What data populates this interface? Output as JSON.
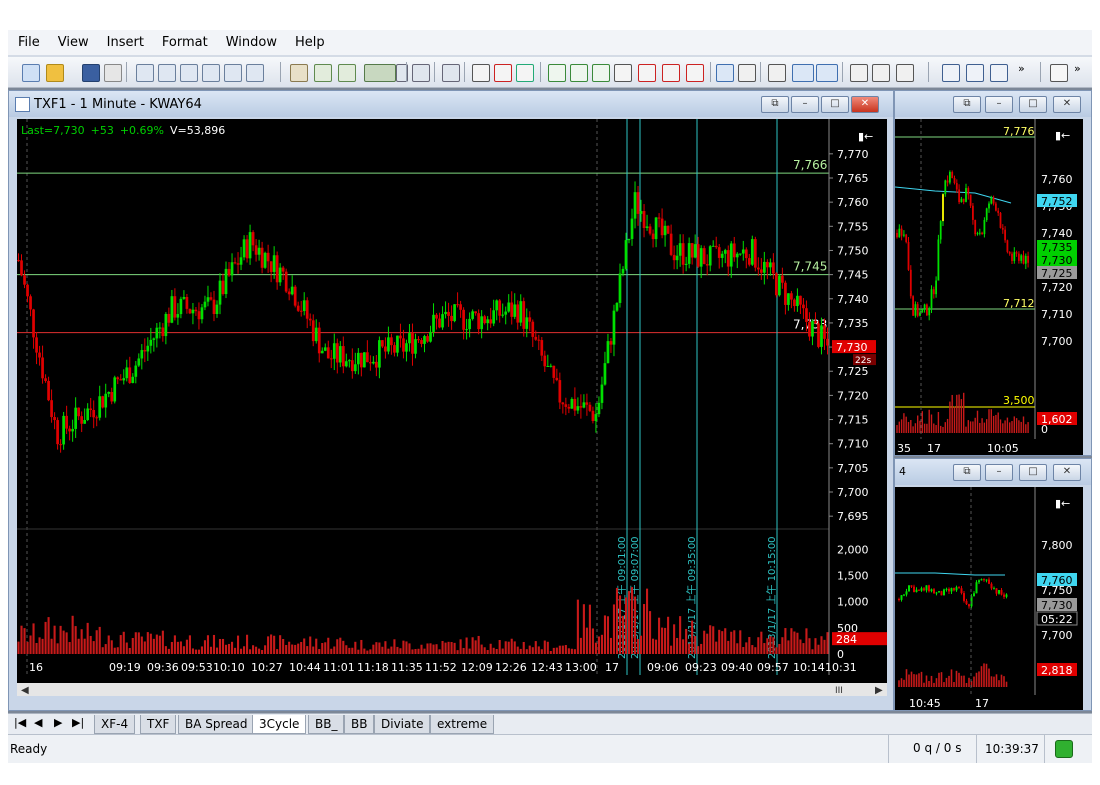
{
  "menu": [
    "File",
    "View",
    "Insert",
    "Format",
    "Window",
    "Help"
  ],
  "main_window": {
    "title": "TXF1 - 1 Minute - KWAY64",
    "last_label": "Last=7,730",
    "change": "+53",
    "change_pct": "+0.69%",
    "volume_label": "V=53,896",
    "price_axis": [
      "7,770",
      "7,765",
      "7,760",
      "7,755",
      "7,750",
      "7,745",
      "7,740",
      "7,735",
      "7,730",
      "7,725",
      "7,720",
      "7,715",
      "7,710",
      "7,705",
      "7,700",
      "7,695"
    ],
    "volume_axis": [
      "2,000",
      "1,500",
      "1,000",
      "500",
      "0"
    ],
    "hline_labels": [
      "7,766",
      "7,745",
      "7,733"
    ],
    "price_tag": "7,730",
    "price_tag_sub": "22s",
    "volume_tag": "284",
    "vline_labels": [
      "2013/1/17 上午 09:01:00",
      "2013/1/17 上午 09:07:00",
      "2013/1/17 上午 09:35:00",
      "2013/1/17 上午 10:15:00"
    ],
    "time_axis": [
      "16",
      "09:19",
      "09:36",
      "09:53",
      "10:10",
      "10:27",
      "10:44",
      "11:01",
      "11:18",
      "11:35",
      "11:52",
      "12:09",
      "12:26",
      "12:43",
      "13:00",
      "17",
      "09:06",
      "09:23",
      "09:40",
      "09:57",
      "10:14",
      "10:31"
    ],
    "scroll_label": "III"
  },
  "right_top": {
    "price_axis": [
      "7,760",
      "7,750",
      "7,740",
      "7,730",
      "7,720",
      "7,710",
      "7,700"
    ],
    "tags": [
      "7,752",
      "7,735",
      "7,730",
      "7,725"
    ],
    "hline_labels": [
      "7,776",
      "7,712",
      "3,500"
    ],
    "volume_tag": "1,602",
    "vol_zero": "0",
    "time_axis": [
      "35",
      "17",
      "10:05"
    ]
  },
  "right_bottom": {
    "label": "4",
    "price_axis": [
      "7,800",
      "7,750",
      "7,700"
    ],
    "tags": [
      "7,760",
      "7,730",
      "05:22"
    ],
    "volume_tag": "2,818",
    "time_axis": [
      "10:45",
      "17"
    ]
  },
  "tabs": [
    "XF-4",
    "TXF",
    "BA Spread",
    "3Cycle",
    "BB_",
    "BB",
    "Diviate",
    "extreme"
  ],
  "active_tab": "3Cycle",
  "tab_nav": [
    "|◀",
    "◀",
    "▶",
    "▶|"
  ],
  "status": {
    "text": "Ready",
    "queue": "0 q / 0 s",
    "time": "10:39:37"
  },
  "colors": {
    "up": "#00e000",
    "down": "#e00000",
    "hline_green": "#7fd97f",
    "hline_red": "#e03030",
    "vline_cyan": "#2ec4c4",
    "volume": "#c81a1a",
    "axis_text": "#ffffff",
    "price_tag_red": "#e00000",
    "tag_cyan": "#3fd6f0",
    "tag_green": "#00d000",
    "tag_gray": "#9a9a9a",
    "label_yellow": "#ffff00"
  },
  "chart_data": {
    "type": "candlestick",
    "x": [
      "16 09:02",
      "09:19",
      "09:36",
      "09:53",
      "10:10",
      "10:27",
      "10:44",
      "11:01",
      "11:18",
      "11:35",
      "11:52",
      "12:09",
      "12:26",
      "12:43",
      "13:00",
      "17 08:46",
      "09:06",
      "09:23",
      "09:40",
      "09:57",
      "10:14",
      "10:31"
    ],
    "close": [
      7748,
      7712,
      7718,
      7726,
      7738,
      7738,
      7752,
      7744,
      7728,
      7728,
      7730,
      7736,
      7736,
      7738,
      7720,
      7716,
      7760,
      7750,
      7748,
      7750,
      7740,
      7730
    ],
    "volume": [
      400,
      500,
      400,
      300,
      300,
      250,
      250,
      250,
      250,
      200,
      200,
      200,
      250,
      200,
      180,
      700,
      900,
      500,
      400,
      350,
      350,
      284
    ],
    "ylim": [
      7694,
      7771
    ],
    "volume_ylim": [
      0,
      2200
    ]
  }
}
